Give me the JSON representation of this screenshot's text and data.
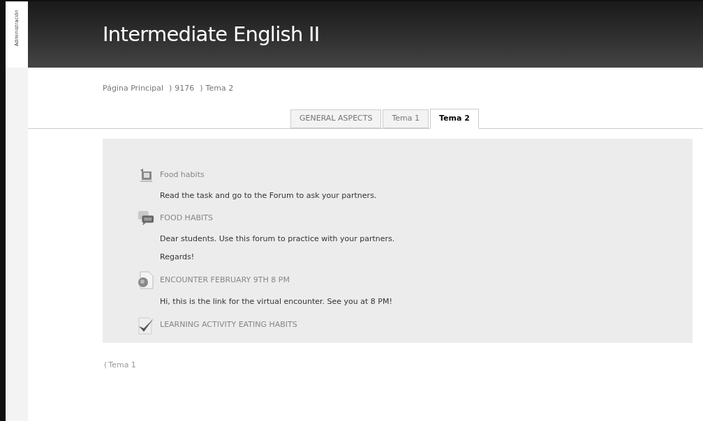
{
  "sidebar": {
    "label": "Administración"
  },
  "header": {
    "title": "Intermediate English II"
  },
  "breadcrumb": {
    "separator": ")",
    "items": [
      "Página Principal",
      "9176",
      "Tema 2"
    ]
  },
  "tabs": [
    {
      "label": "GENERAL ASPECTS",
      "selected": false
    },
    {
      "label": "Tema 1",
      "selected": false
    },
    {
      "label": "Tema 2",
      "selected": true
    }
  ],
  "activities": [
    {
      "kind": "resource",
      "title": "Food habits",
      "description": [
        "Read the task and go to the Forum to ask your partners."
      ]
    },
    {
      "kind": "forum",
      "title": "FOOD HABITS",
      "description": [
        "Dear students. Use this forum to practice with your partners.",
        "Regards!"
      ]
    },
    {
      "kind": "url",
      "title": "ENCOUNTER FEBRUARY 9TH 8 PM",
      "description": [
        "Hi, this is the link for the virtual encounter. See you at  8 PM!"
      ]
    },
    {
      "kind": "assignment",
      "title": "LEARNING ACTIVITY EATING HABITS"
    }
  ],
  "footer": {
    "arrow": "(",
    "label": "Tema 1"
  }
}
